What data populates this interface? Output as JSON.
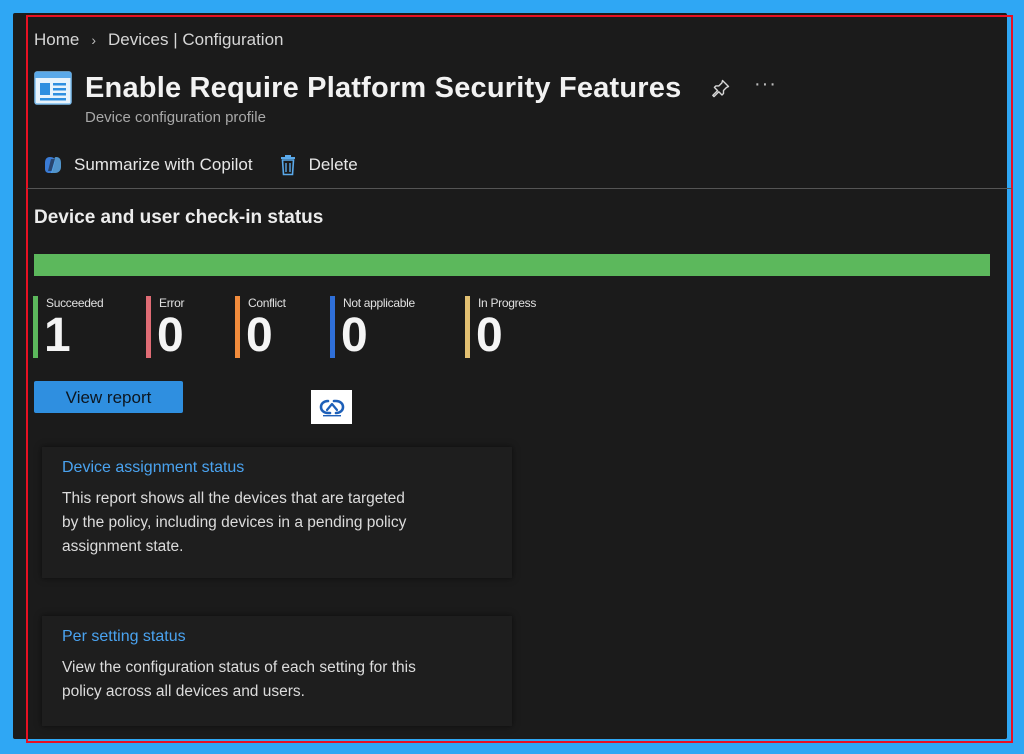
{
  "breadcrumb": {
    "home": "Home",
    "separator": "›",
    "section": "Devices | Configuration"
  },
  "header": {
    "title": "Enable Require Platform Security Features",
    "subtitle": "Device configuration profile",
    "pin_icon": "pin-icon",
    "more_icon": "more-icon",
    "more_label": "···"
  },
  "toolbar": {
    "copilot_label": "Summarize with Copilot",
    "delete_label": "Delete"
  },
  "checkin": {
    "title": "Device and user check-in status",
    "progress_fraction": 1.0,
    "stats": [
      {
        "label": "Succeeded",
        "value": "1",
        "color": "#5cb85c"
      },
      {
        "label": "Error",
        "value": "0",
        "color": "#e06c75"
      },
      {
        "label": "Conflict",
        "value": "0",
        "color": "#f28c3c"
      },
      {
        "label": "Not applicable",
        "value": "0",
        "color": "#2f6fd8"
      },
      {
        "label": "In Progress",
        "value": "0",
        "color": "#e2c072"
      }
    ],
    "view_report_label": "View report"
  },
  "reports": [
    {
      "title": "Device assignment status",
      "description": "This report shows all the devices that are targeted by the policy, including devices in a pending policy assignment state."
    },
    {
      "title": "Per setting status",
      "description": "View the configuration status of each setting for this policy across all devices and users."
    }
  ],
  "colors": {
    "accent": "#2f8fe0",
    "link": "#4aa3f0",
    "success": "#5cb85c",
    "frame_border": "#e81123",
    "outer_background": "#2fa7f4"
  }
}
